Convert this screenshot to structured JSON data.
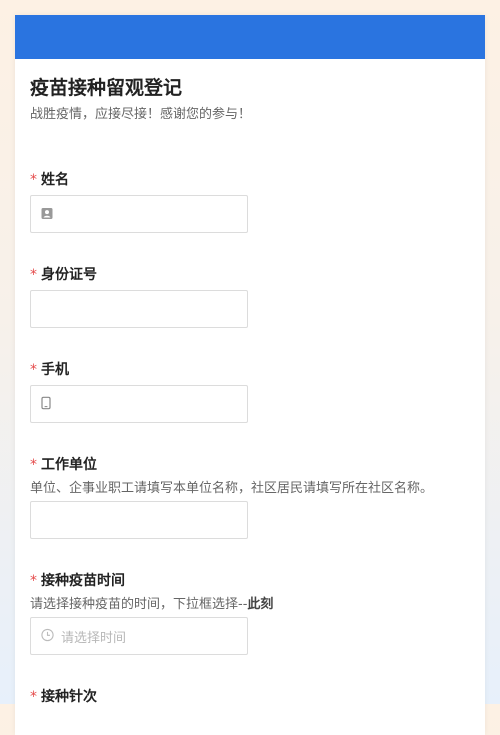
{
  "form": {
    "title": "疫苗接种留观登记",
    "subtitle": "战胜疫情，应接尽接！感谢您的参与！"
  },
  "fields": {
    "name": {
      "required": "*",
      "label": "姓名"
    },
    "idcard": {
      "required": "*",
      "label": "身份证号"
    },
    "phone": {
      "required": "*",
      "label": "手机"
    },
    "work": {
      "required": "*",
      "label": "工作单位",
      "desc": "单位、企事业职工请填写本单位名称，社区居民请填写所在社区名称。"
    },
    "time": {
      "required": "*",
      "label": "接种疫苗时间",
      "desc_prefix": "请选择接种疫苗的时间，下拉框选择--",
      "desc_bold": "此刻",
      "placeholder": "请选择时间"
    },
    "dose": {
      "required": "*",
      "label": "接种针次"
    }
  },
  "icons": {
    "name": "contact-card-icon",
    "phone": "mobile-phone-icon",
    "time": "clock-icon"
  },
  "colors": {
    "header": "#2a74e0",
    "required": "#e54b4b"
  }
}
